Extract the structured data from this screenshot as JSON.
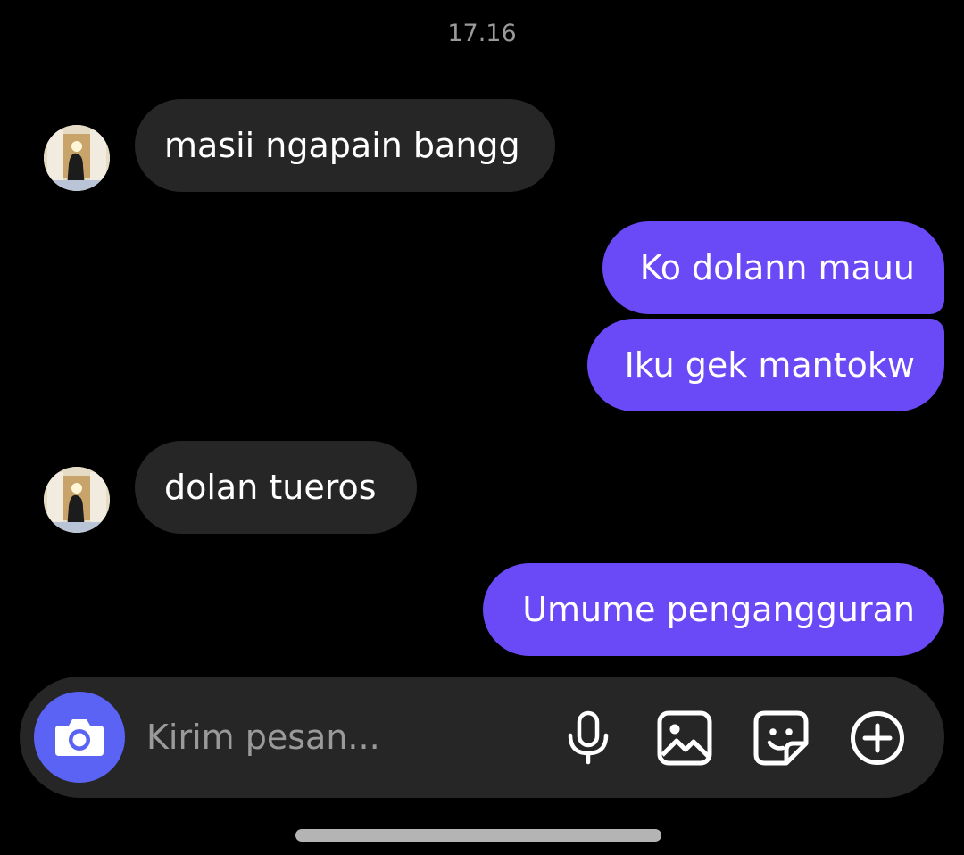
{
  "thread": {
    "timestamp": "17.16"
  },
  "messages": [
    {
      "sender": "them",
      "text": "masii ngapain bangg"
    },
    {
      "sender": "me",
      "text": "Ko dolann mauu"
    },
    {
      "sender": "me",
      "text": "Iku gek mantokw"
    },
    {
      "sender": "them",
      "text": "dolan tueros"
    },
    {
      "sender": "me",
      "text": "Umume pengangguran"
    }
  ],
  "composer": {
    "placeholder": "Kirim pesan...",
    "icons": [
      "camera-icon",
      "microphone-icon",
      "gallery-icon",
      "sticker-icon",
      "plus-icon"
    ]
  },
  "colors": {
    "background": "#000000",
    "incoming_bubble": "#262626",
    "outgoing_bubble": "#6a49f6",
    "camera_button": "#5b63f4",
    "composer_bg": "#262626"
  }
}
